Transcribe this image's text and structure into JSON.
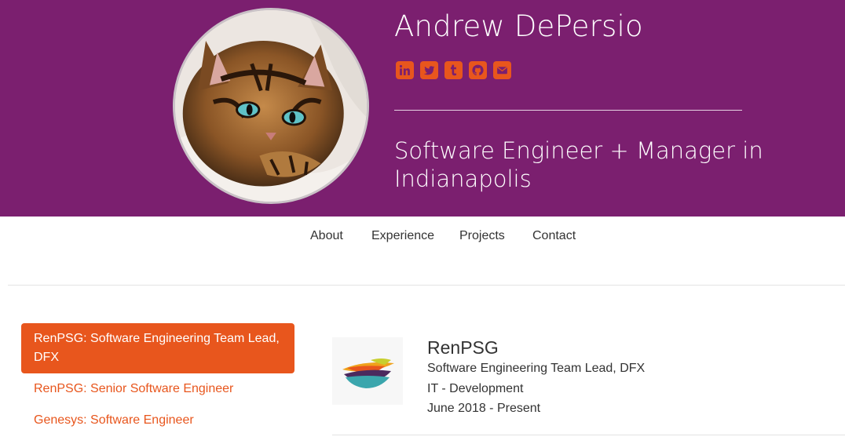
{
  "header": {
    "name": "Andrew DePersio",
    "tagline": "Software Engineer + Manager in Indianapolis",
    "social_icons": [
      "linkedin-icon",
      "twitter-icon",
      "tumblr-icon",
      "github-icon",
      "email-icon"
    ]
  },
  "nav": {
    "items": [
      "About",
      "Experience",
      "Projects",
      "Contact"
    ],
    "active": "Experience"
  },
  "jobs": [
    {
      "label": "RenPSG: Software Engineering Team Lead, DFX",
      "active": true
    },
    {
      "label": "RenPSG: Senior Software Engineer",
      "active": false
    },
    {
      "label": "Genesys: Software Engineer",
      "active": false
    }
  ],
  "detail": {
    "company": "RenPSG",
    "title": "Software Engineering Team Lead, DFX",
    "department": "IT - Development",
    "dates": "June 2018 - Present"
  },
  "colors": {
    "header_bg": "#7b1f6f",
    "accent": "#e8561d",
    "text": "#333333"
  }
}
